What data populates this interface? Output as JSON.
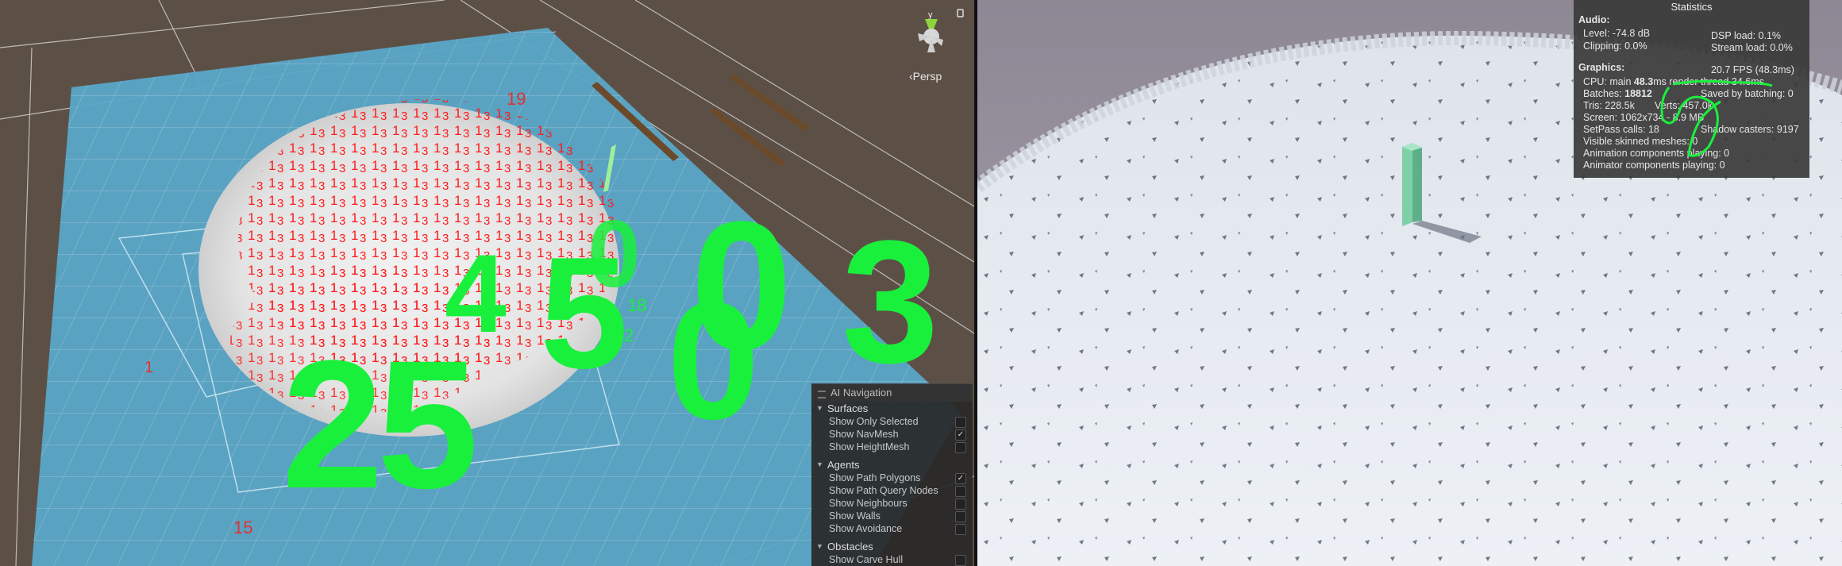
{
  "scene_view": {
    "labels_red": [
      "19",
      "1",
      "15"
    ],
    "overlay_numbers": [
      "25",
      "5",
      "0",
      "3",
      "0",
      "4",
      "0",
      "18",
      "2"
    ],
    "persp_label": "Persp",
    "gizmo_axis": "y"
  },
  "ai_navigation": {
    "title": "AI Navigation",
    "sections": [
      {
        "label": "Surfaces",
        "items": [
          {
            "label": "Show Only Selected",
            "checked": false
          },
          {
            "label": "Show NavMesh",
            "checked": true
          },
          {
            "label": "Show HeightMesh",
            "checked": false
          }
        ]
      },
      {
        "label": "Agents",
        "items": [
          {
            "label": "Show Path Polygons",
            "checked": true
          },
          {
            "label": "Show Path Query Nodes",
            "checked": false
          },
          {
            "label": "Show Neighbours",
            "checked": false
          },
          {
            "label": "Show Walls",
            "checked": false
          },
          {
            "label": "Show Avoidance",
            "checked": false
          }
        ]
      },
      {
        "label": "Obstacles",
        "items": [
          {
            "label": "Show Carve Hull",
            "checked": false
          }
        ]
      }
    ]
  },
  "statistics": {
    "title": "Statistics",
    "audio_header": "Audio:",
    "level": "Level: -74.8 dB",
    "clipping": "Clipping: 0.0%",
    "dsp_load": "DSP load: 0.1%",
    "stream_load": "Stream load: 0.0%",
    "graphics_header": "Graphics:",
    "fps": "20.7 FPS (48.3ms)",
    "cpu_prefix": "CPU: main ",
    "cpu_main": "48.3",
    "cpu_suffix": "ms  render thread 34.6ms",
    "batches_prefix": "Batches: ",
    "batches": "18812",
    "saved_batching": "Saved by batching: 0",
    "tris": "Tris: 228.5k",
    "verts": "Verts: 457.0k",
    "screen": "Screen: 1062x734 - 8.9 MB",
    "setpass": "SetPass calls: 18",
    "shadow_casters": "Shadow casters: 9197",
    "skinned": "Visible skinned meshes: 0",
    "anim_components": "Animation components playing: 0",
    "animator_components": "Animator components playing: 0"
  },
  "colors": {
    "navmesh": "#5aa6c8",
    "label_red": "#ff1a1a",
    "overlay_green": "#19f03c",
    "ground_game": "#e9edf2"
  }
}
